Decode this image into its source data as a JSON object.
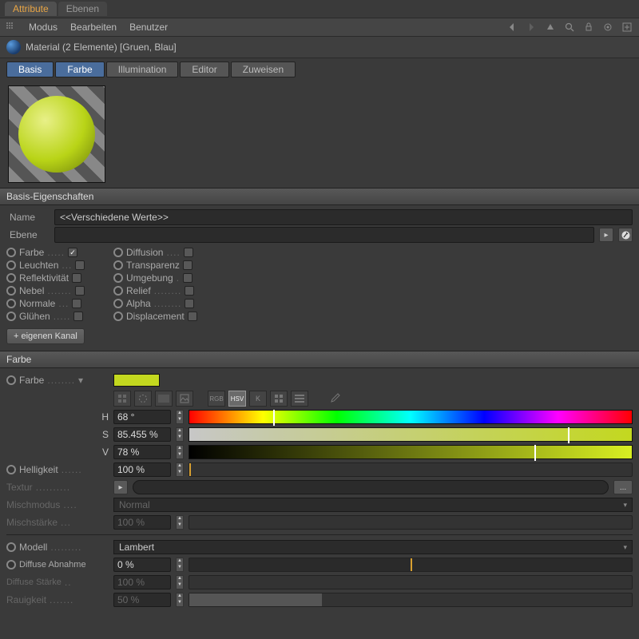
{
  "topTabs": {
    "active": "Attribute",
    "inactive": "Ebenen"
  },
  "menu": {
    "m1": "Modus",
    "m2": "Bearbeiten",
    "m3": "Benutzer"
  },
  "title": "Material (2 Elemente) [Gruen, Blau]",
  "subTabs": {
    "t1": "Basis",
    "t2": "Farbe",
    "t3": "Illumination",
    "t4": "Editor",
    "t5": "Zuweisen"
  },
  "basisHead": "Basis-Eigenschaften",
  "name": {
    "label": "Name",
    "value": "<<Verschiedene Werte>>"
  },
  "ebene": {
    "label": "Ebene",
    "value": ""
  },
  "channels": {
    "farbe": "Farbe",
    "diffusion": "Diffusion",
    "leuchten": "Leuchten",
    "transparenz": "Transparenz",
    "reflekt": "Reflektivität",
    "umgebung": "Umgebung",
    "nebel": "Nebel",
    "relief": "Relief",
    "normale": "Normale",
    "alpha": "Alpha",
    "gluehen": "Glühen",
    "displacement": "Displacement"
  },
  "addChannel": "+ eigenen Kanal",
  "farbeHead": "Farbe",
  "farbeLabel": "Farbe",
  "swatchColor": "#c3d81f",
  "iconModes": {
    "rgb": "RGB",
    "hsv": "HSV",
    "k": "K"
  },
  "hsv": {
    "h": {
      "label": "H",
      "val": "68 °",
      "pos": 18.9
    },
    "s": {
      "label": "S",
      "val": "85.455 %",
      "pos": 85.5
    },
    "v": {
      "label": "V",
      "val": "78 %",
      "pos": 78
    }
  },
  "hellig": {
    "label": "Helligkeit",
    "val": "100 %"
  },
  "textur": {
    "label": "Textur"
  },
  "mischmodus": {
    "label": "Mischmodus",
    "val": "Normal"
  },
  "mischstaerke": {
    "label": "Mischstärke",
    "val": "100 %"
  },
  "modell": {
    "label": "Modell",
    "val": "Lambert"
  },
  "diffAbnahme": {
    "label": "Diffuse Abnahme",
    "val": "0 %"
  },
  "diffStaerke": {
    "label": "Diffuse Stärke",
    "val": "100 %"
  },
  "rauigkeit": {
    "label": "Rauigkeit",
    "val": "50 %"
  }
}
